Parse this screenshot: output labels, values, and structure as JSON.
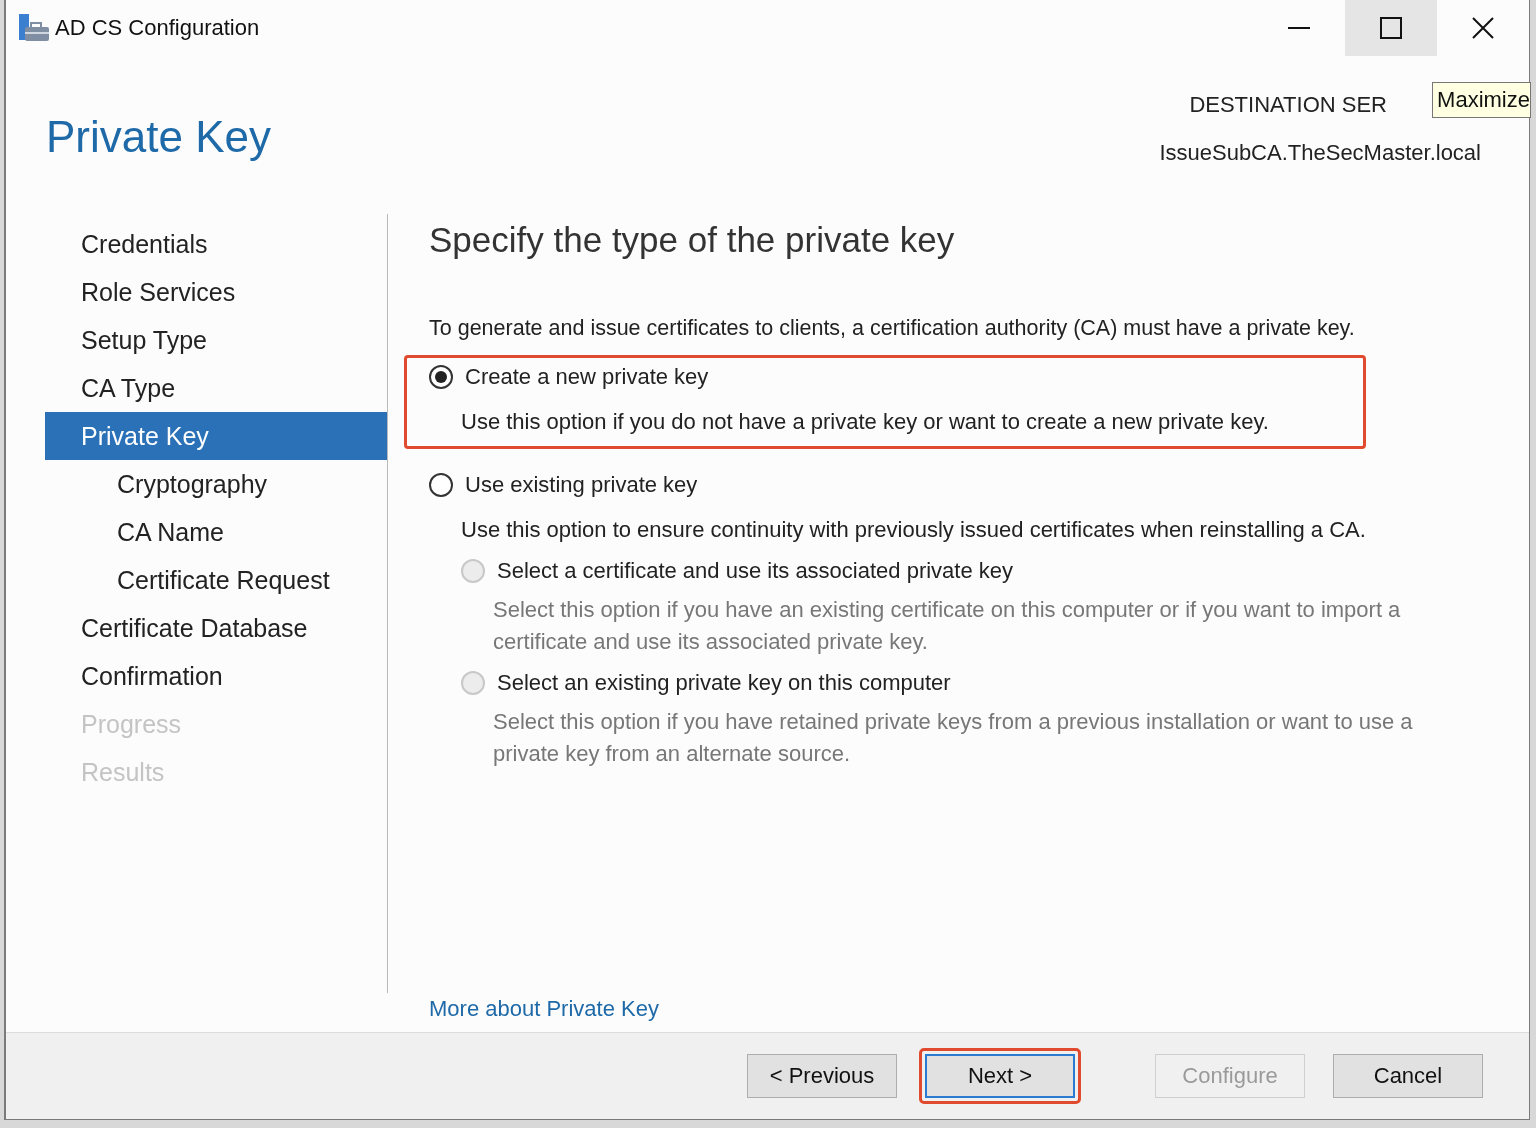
{
  "window": {
    "title": "AD CS Configuration",
    "tooltip": "Maximize"
  },
  "header": {
    "page_title": "Private Key",
    "destination_label": "DESTINATION SER",
    "destination_server": "IssueSubCA.TheSecMaster.local"
  },
  "sidebar": {
    "items": [
      {
        "label": "Credentials",
        "selected": false,
        "disabled": false
      },
      {
        "label": "Role Services",
        "selected": false,
        "disabled": false
      },
      {
        "label": "Setup Type",
        "selected": false,
        "disabled": false
      },
      {
        "label": "CA Type",
        "selected": false,
        "disabled": false
      },
      {
        "label": "Private Key",
        "selected": true,
        "disabled": false,
        "children": [
          {
            "label": "Cryptography",
            "selected": false,
            "disabled": false
          },
          {
            "label": "CA Name",
            "selected": false,
            "disabled": false
          },
          {
            "label": "Certificate Request",
            "selected": false,
            "disabled": false
          }
        ]
      },
      {
        "label": "Certificate Database",
        "selected": false,
        "disabled": false
      },
      {
        "label": "Confirmation",
        "selected": false,
        "disabled": false
      },
      {
        "label": "Progress",
        "selected": false,
        "disabled": true
      },
      {
        "label": "Results",
        "selected": false,
        "disabled": true
      }
    ]
  },
  "content": {
    "heading": "Specify the type of the private key",
    "intro": "To generate and issue certificates to clients, a certification authority (CA) must have a private key.",
    "options": [
      {
        "label": "Create a new private key",
        "description": "Use this option if you do not have a private key or want to create a new private key.",
        "selected": true,
        "disabled": false,
        "highlighted": true
      },
      {
        "label": "Use existing private key",
        "description": "Use this option to ensure continuity with previously issued certificates when reinstalling a CA.",
        "selected": false,
        "disabled": false,
        "highlighted": false,
        "children": [
          {
            "label": "Select a certificate and use its associated private key",
            "description": "Select this option if you have an existing certificate on this computer or if you want to import a certificate and use its associated private key.",
            "selected": false,
            "disabled": true
          },
          {
            "label": "Select an existing private key on this computer",
            "description": "Select this option if you have retained private keys from a previous installation or want to use a private key from an alternate source.",
            "selected": false,
            "disabled": true
          }
        ]
      }
    ],
    "link": "More about Private Key"
  },
  "buttons": [
    {
      "label": "< Previous",
      "disabled": false,
      "focused": false,
      "highlighted": false
    },
    {
      "label": "Next >",
      "disabled": false,
      "focused": true,
      "highlighted": true
    },
    {
      "label": "Configure",
      "disabled": true,
      "focused": false,
      "highlighted": false
    },
    {
      "label": "Cancel",
      "disabled": false,
      "focused": false,
      "highlighted": false
    }
  ]
}
